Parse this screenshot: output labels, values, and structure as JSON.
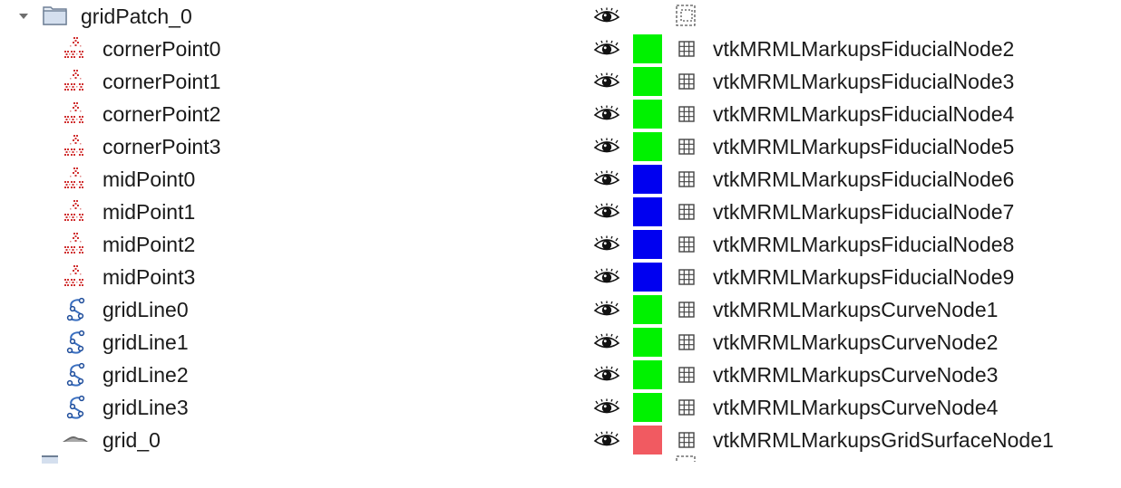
{
  "folder": {
    "name": "gridPatch_0",
    "expanded": true
  },
  "colors": {
    "green": "#00f200",
    "blue": "#0000f0",
    "red": "#f15a61"
  },
  "nodes": [
    {
      "name": "cornerPoint0",
      "id": "vtkMRMLMarkupsFiducialNode2",
      "icon": "fiducial-icon",
      "color": "#00f200"
    },
    {
      "name": "cornerPoint1",
      "id": "vtkMRMLMarkupsFiducialNode3",
      "icon": "fiducial-icon",
      "color": "#00f200"
    },
    {
      "name": "cornerPoint2",
      "id": "vtkMRMLMarkupsFiducialNode4",
      "icon": "fiducial-icon",
      "color": "#00f200"
    },
    {
      "name": "cornerPoint3",
      "id": "vtkMRMLMarkupsFiducialNode5",
      "icon": "fiducial-icon",
      "color": "#00f200"
    },
    {
      "name": "midPoint0",
      "id": "vtkMRMLMarkupsFiducialNode6",
      "icon": "fiducial-icon",
      "color": "#0000f0"
    },
    {
      "name": "midPoint1",
      "id": "vtkMRMLMarkupsFiducialNode7",
      "icon": "fiducial-icon",
      "color": "#0000f0"
    },
    {
      "name": "midPoint2",
      "id": "vtkMRMLMarkupsFiducialNode8",
      "icon": "fiducial-icon",
      "color": "#0000f0"
    },
    {
      "name": "midPoint3",
      "id": "vtkMRMLMarkupsFiducialNode9",
      "icon": "fiducial-icon",
      "color": "#0000f0"
    },
    {
      "name": "gridLine0",
      "id": "vtkMRMLMarkupsCurveNode1",
      "icon": "curve-icon",
      "color": "#00f200"
    },
    {
      "name": "gridLine1",
      "id": "vtkMRMLMarkupsCurveNode2",
      "icon": "curve-icon",
      "color": "#00f200"
    },
    {
      "name": "gridLine2",
      "id": "vtkMRMLMarkupsCurveNode3",
      "icon": "curve-icon",
      "color": "#00f200"
    },
    {
      "name": "gridLine3",
      "id": "vtkMRMLMarkupsCurveNode4",
      "icon": "curve-icon",
      "color": "#00f200"
    },
    {
      "name": "grid_0",
      "id": "vtkMRMLMarkupsGridSurfaceNode1",
      "icon": "grid-surface-icon",
      "color": "#f15a61"
    }
  ]
}
